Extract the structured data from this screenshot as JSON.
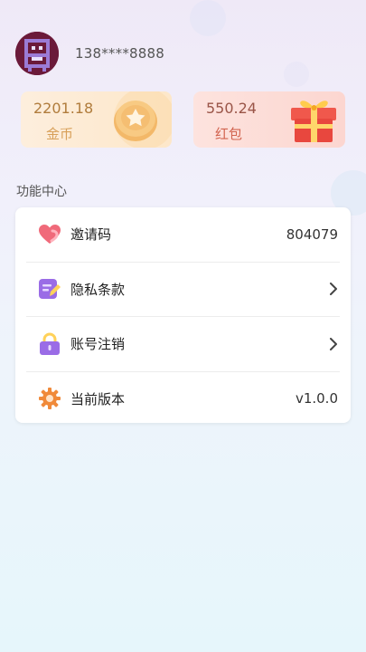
{
  "profile": {
    "phone": "138****8888"
  },
  "wallet": {
    "coins": {
      "value": "2201.18",
      "label": "金币"
    },
    "redpacket": {
      "value": "550.24",
      "label": "红包"
    }
  },
  "section": {
    "title": "功能中心"
  },
  "menu": [
    {
      "label": "邀请码",
      "value": "804079",
      "icon": "heart-icon"
    },
    {
      "label": "隐私条款",
      "value": "",
      "icon": "document-edit-icon"
    },
    {
      "label": "账号注销",
      "value": "",
      "icon": "lock-icon"
    },
    {
      "label": "当前版本",
      "value": "v1.0.0",
      "icon": "gear-icon"
    }
  ],
  "colors": {
    "coin_text": "#b07c3c",
    "redpacket_text": "#d2644f",
    "heart": "#f06a7a",
    "purple": "#9a6ce6",
    "gear": "#f08a3a"
  }
}
